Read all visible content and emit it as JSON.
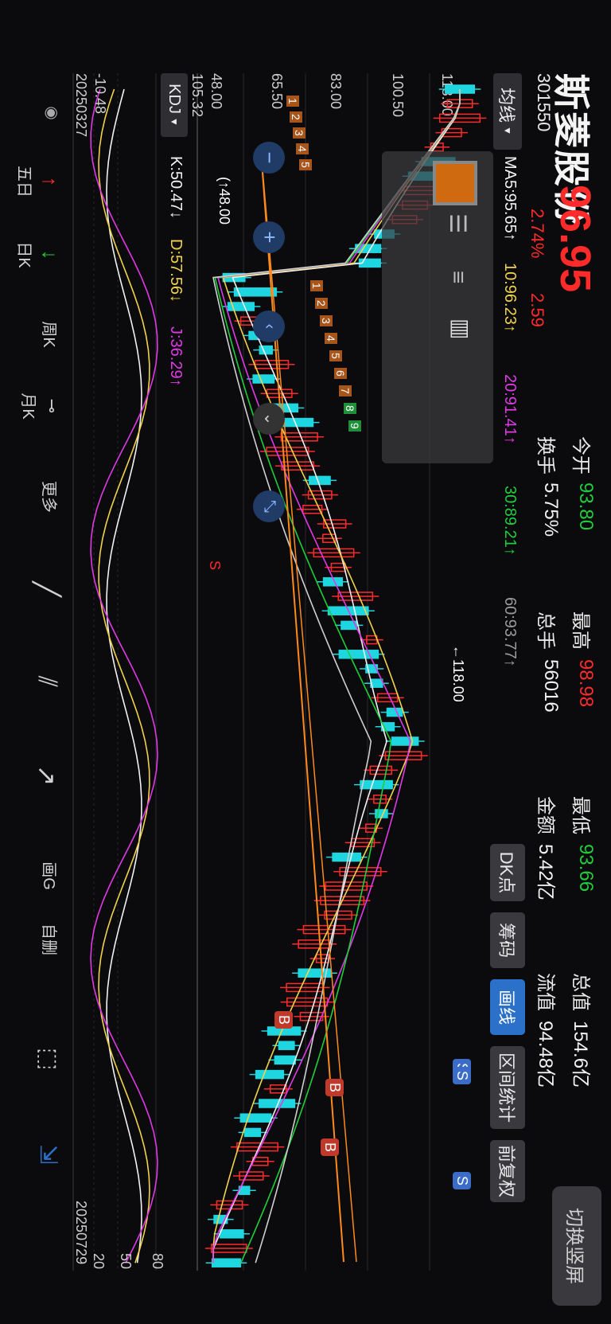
{
  "stock": {
    "name": "斯菱股份",
    "code": "301550",
    "price": "96.95",
    "change_pct": "2.74%",
    "change": "2.59"
  },
  "quote": {
    "open_label": "今开",
    "open": "93.80",
    "high_label": "最高",
    "high": "98.98",
    "low_label": "最低",
    "low": "93.66",
    "total_value_label": "总值",
    "total_value": "154.6亿",
    "turnover_label": "换手",
    "turnover": "5.75%",
    "volume_label": "总手",
    "volume": "56016",
    "amount_label": "金额",
    "amount": "5.42亿",
    "float_value_label": "流值",
    "float_value": "94.48亿"
  },
  "switch_label": "切换竖屏",
  "ma": {
    "selector": "均线",
    "ma5": "MA5:95.65↑",
    "ma10": "10:96.23↑",
    "ma20": "20:91.41↑",
    "ma30": "30:89.21↑",
    "ma60": "60:93.77↑"
  },
  "toolbar": {
    "dk": "DK点",
    "chips": "筹码",
    "draw": "画线",
    "range": "区间统计",
    "adjust": "前复权"
  },
  "price_axis": {
    "top": "118.00",
    "p1": "100.50",
    "p2": "83.00",
    "p3": "65.50",
    "p4": "48.00",
    "max_marker": "←118.00",
    "min_marker": "(↑48.00"
  },
  "kdj": {
    "selector": "KDJ",
    "k": "K:50.47↓",
    "d": "D:57.56↓",
    "j": "J:36.29↑",
    "axis_top": "105.32",
    "axis_bottom": "-10.48",
    "lvl80": "80",
    "lvl50": "50",
    "lvl20": "20"
  },
  "dates": {
    "start": "20250327",
    "end": "20250729"
  },
  "signals": {
    "s": "S",
    "b": "B",
    "seq_a": [
      "1",
      "2",
      "3",
      "4",
      "5",
      "6",
      "7",
      "8",
      "9"
    ],
    "seq_b": [
      "1",
      "2",
      "3",
      "4",
      "5"
    ]
  },
  "bottom_tools": [
    "五日",
    "日K",
    "周K",
    "月K",
    "更多",
    "划线",
    "平行线",
    "射线",
    "画G",
    "自删",
    "笔"
  ],
  "colors": {
    "up": "#ff2b2b",
    "down": "#1ed6e0",
    "ma5": "#f2f2f2",
    "ma10": "#f1d34a",
    "ma20": "#e039e6",
    "ma30": "#1ecf3a",
    "ma60": "#cfcfcf",
    "accent": "#2b70c9"
  }
}
